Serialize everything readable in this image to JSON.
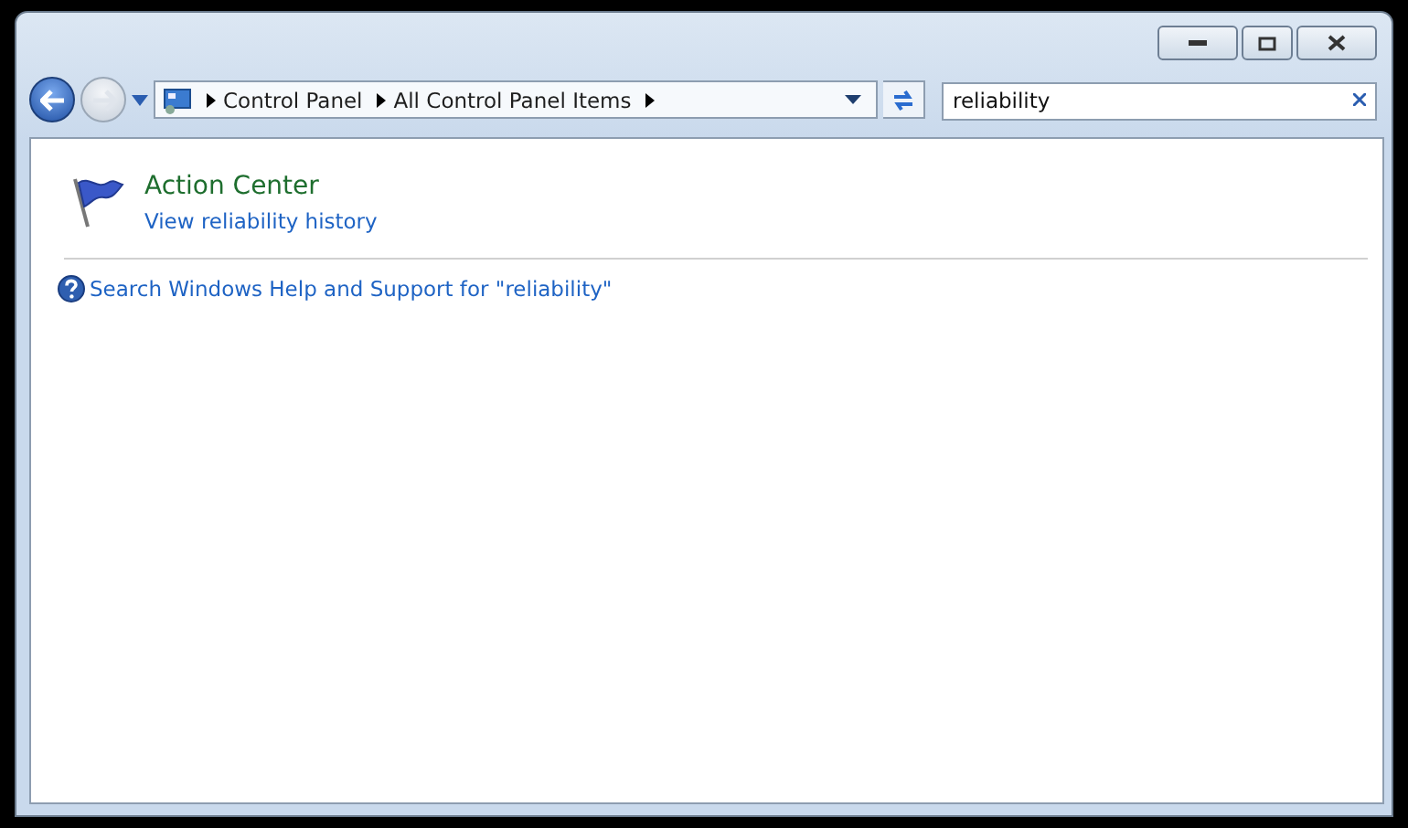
{
  "address_bar": {
    "crumbs": [
      "Control Panel",
      "All Control Panel Items"
    ]
  },
  "search": {
    "value": "reliability"
  },
  "results": [
    {
      "title": "Action Center",
      "link": "View reliability history"
    }
  ],
  "help_link": "Search Windows Help and Support for \"reliability\""
}
